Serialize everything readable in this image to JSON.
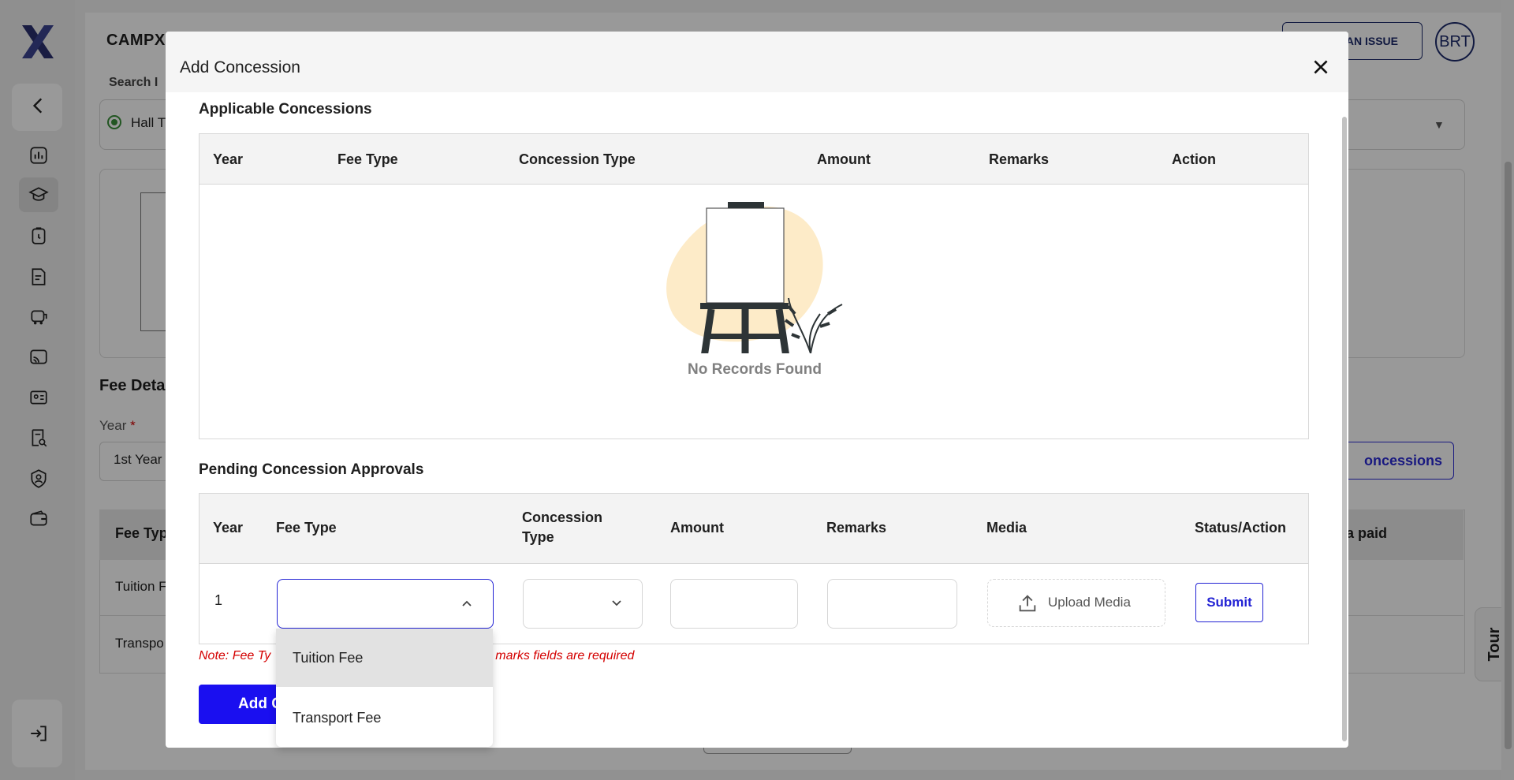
{
  "app": {
    "brand": "CAMPX",
    "report_issue_label": "AN ISSUE",
    "avatar_initials": "BRT",
    "tour_label": "Tour"
  },
  "sidebar": {
    "icons": [
      "back-arrow-icon",
      "dashboard-icon",
      "graduation-cap-icon",
      "clipboard-timer-icon",
      "document-icon",
      "bus-icon",
      "broadcast-icon",
      "id-card-icon",
      "receipt-search-icon",
      "user-shield-icon",
      "wallet-icon",
      "logout-icon"
    ]
  },
  "background": {
    "search_label": "Search I",
    "radio_label": "Hall T",
    "fee_details_title": "Fee Deta",
    "year_label": "Year",
    "year_required": "*",
    "year_value": "1st Year",
    "concessions_button": "oncessions",
    "table_header_first": "Fee Typ",
    "table_header_last": "ra paid",
    "row1": "Tuition F",
    "row2": "Transpo"
  },
  "modal": {
    "title": "Add Concession",
    "applicable": {
      "title": "Applicable Concessions",
      "columns": [
        "Year",
        "Fee Type",
        "Concession Type",
        "Amount",
        "Remarks",
        "Action"
      ],
      "empty_text": "No Records Found"
    },
    "pending": {
      "title": "Pending Concession Approvals",
      "columns": [
        "Year",
        "Fee Type",
        "Concession Type",
        "Amount",
        "Remarks",
        "Media",
        "Status/Action"
      ],
      "row": {
        "year": "1",
        "fee_type_value": "",
        "concession_type_value": "",
        "amount_value": "",
        "remarks_value": "",
        "upload_label": "Upload Media",
        "submit_label": "Submit"
      }
    },
    "note_left": "Note: Fee Ty",
    "note_right": "marks fields are required",
    "add_button": "Add C",
    "fee_type_options": [
      "Tuition Fee",
      "Transport Fee"
    ]
  },
  "colors": {
    "accent": "#2323d4",
    "primary_button": "#1a0ff0",
    "error": "#d40000",
    "illustration_blob": "#fdebc8"
  }
}
